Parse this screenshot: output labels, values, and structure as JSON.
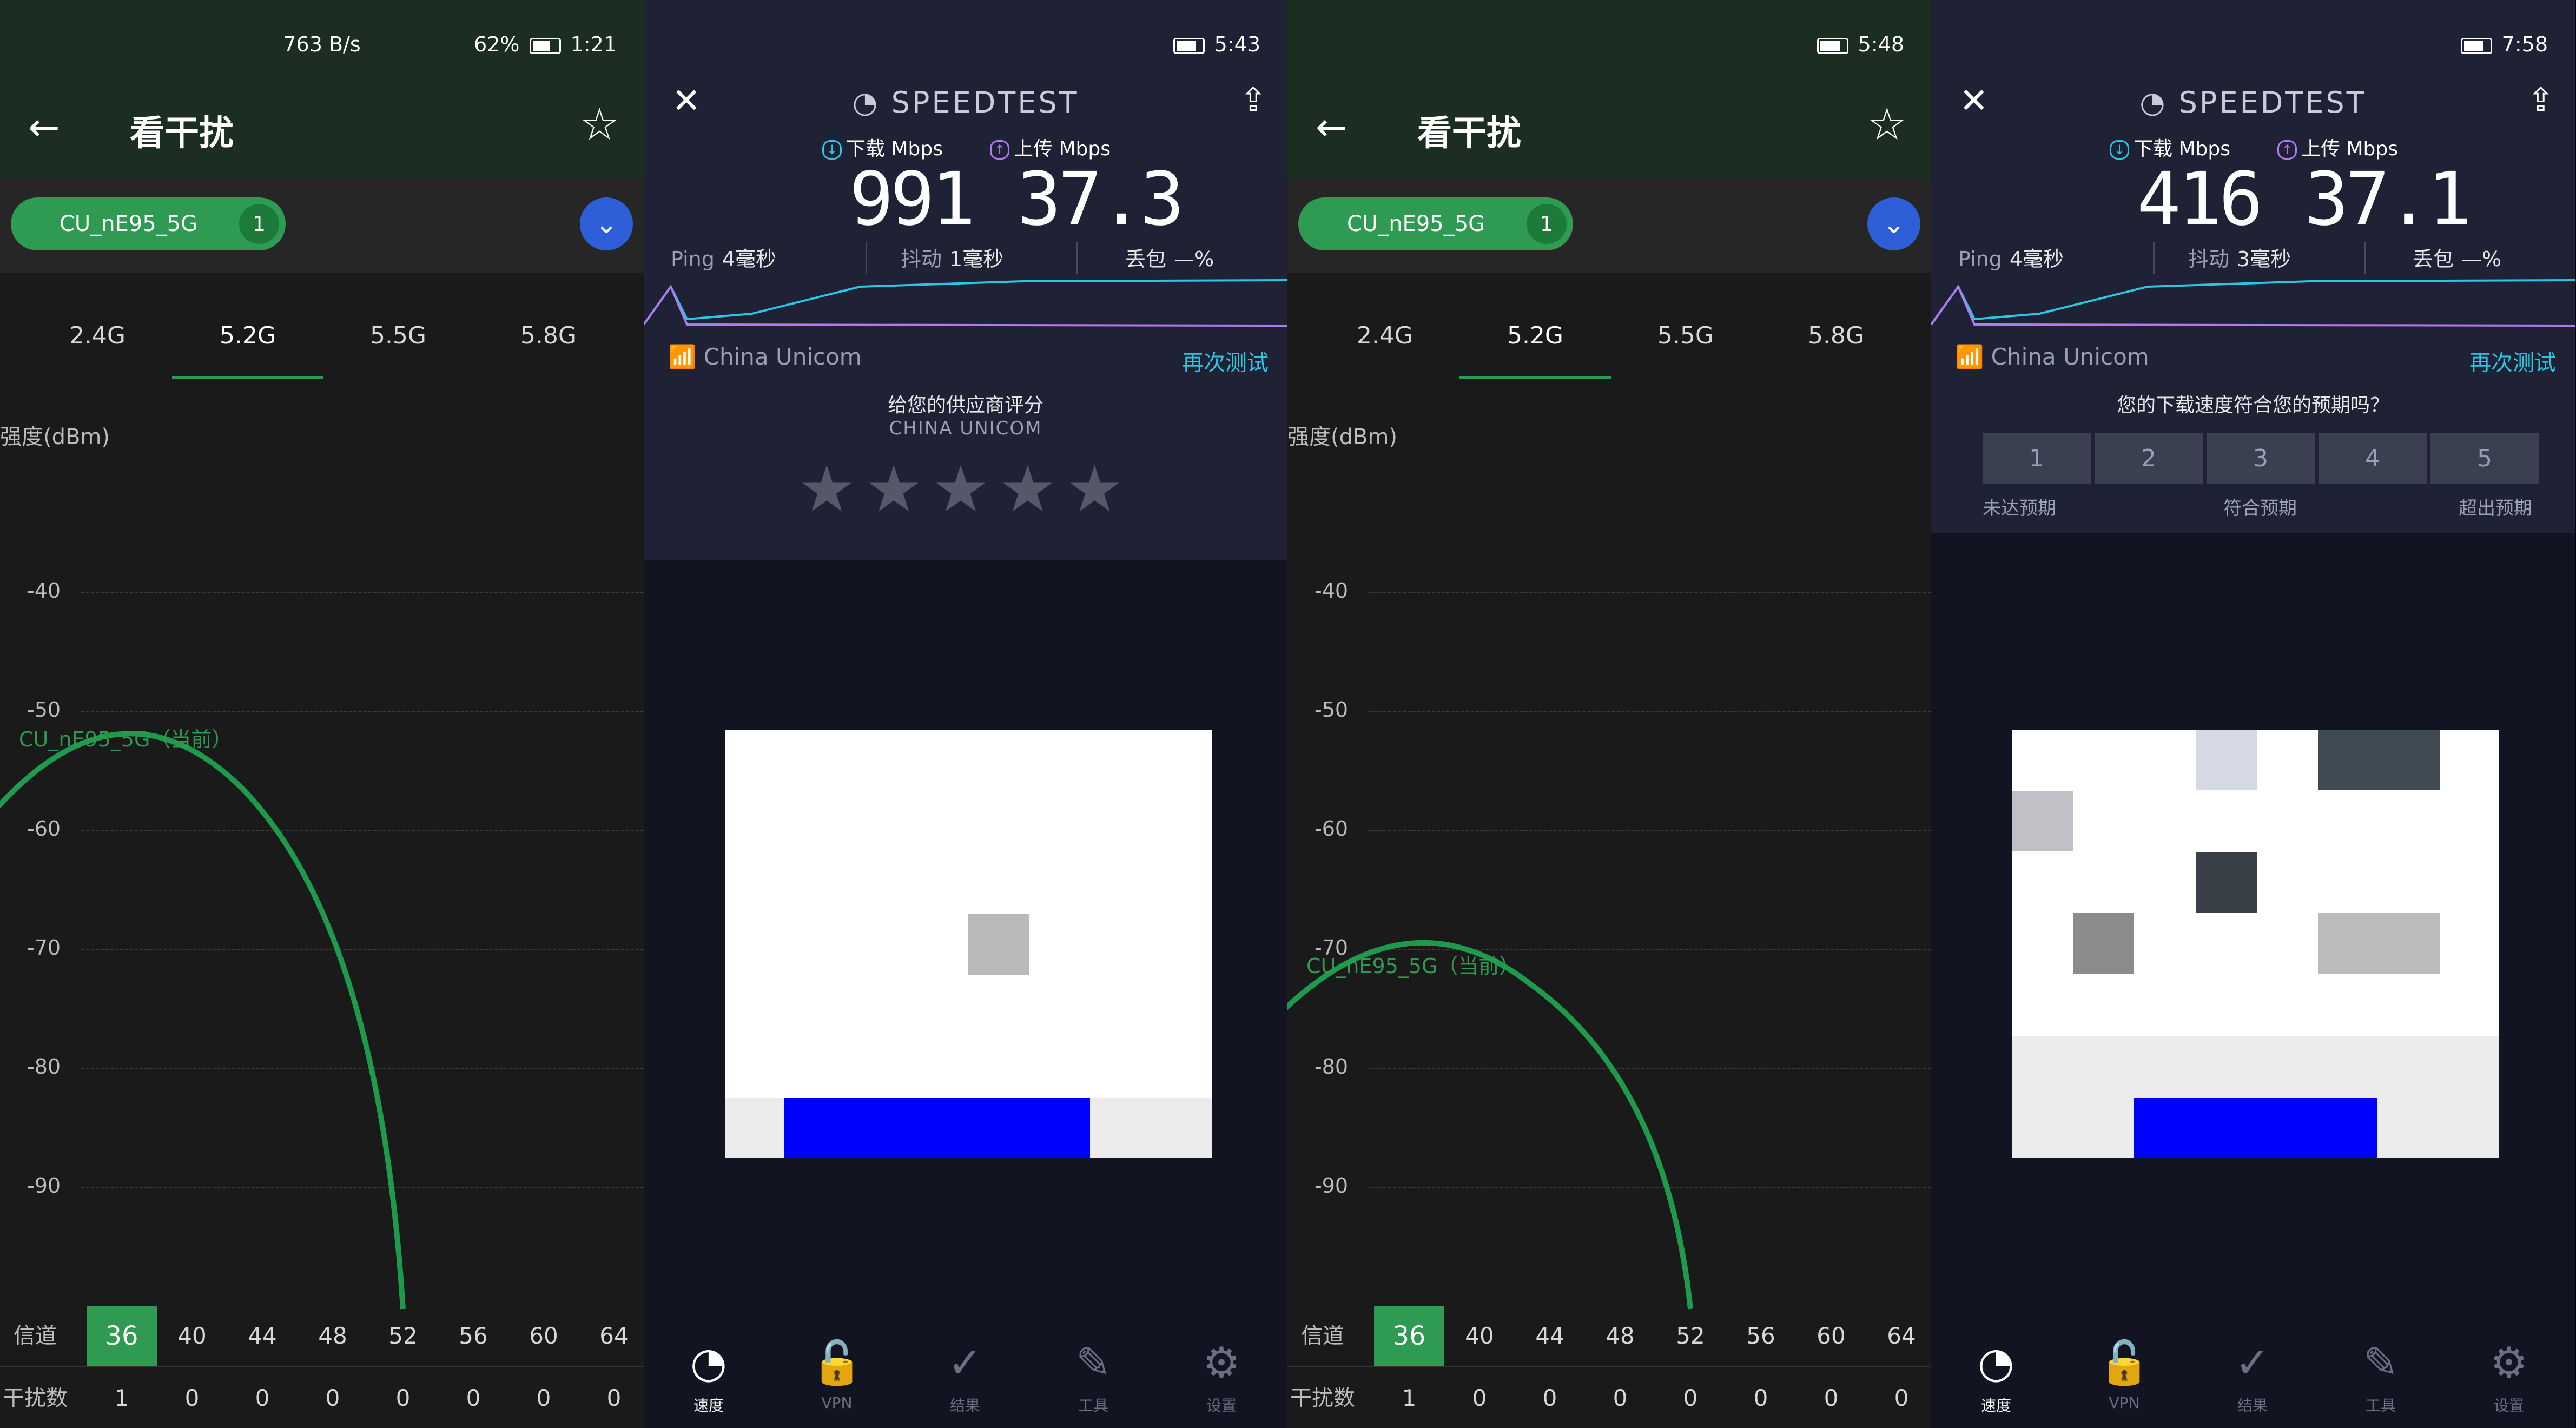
{
  "analyzer_screens": [
    {
      "status": {
        "speed": "763 B/s",
        "battery": "62%",
        "time": "1:21"
      },
      "title": "看干扰",
      "ssid_chip": {
        "name": "CU_nE95_5G",
        "count": "1"
      },
      "bands": [
        "2.4G",
        "5.2G",
        "5.5G",
        "5.8G"
      ],
      "selected_band": "5.2G",
      "y_axis_label": "强度(dBm)",
      "y_ticks": [
        "-40",
        "-50",
        "-60",
        "-70",
        "-80",
        "-90"
      ],
      "network_label": "CU_nE95_5G（当前）",
      "network_signal_dbm": -53,
      "channel_header": "信道",
      "interference_header": "干扰数",
      "channels": [
        "36",
        "40",
        "44",
        "48",
        "52",
        "56",
        "60",
        "64"
      ],
      "interference": [
        "1",
        "0",
        "0",
        "0",
        "0",
        "0",
        "0",
        "0"
      ],
      "active_channel": "36"
    },
    {
      "status": {
        "time": "5:48"
      },
      "title": "看干扰",
      "ssid_chip": {
        "name": "CU_nE95_5G",
        "count": "1"
      },
      "bands": [
        "2.4G",
        "5.2G",
        "5.5G",
        "5.8G"
      ],
      "selected_band": "5.2G",
      "y_axis_label": "强度(dBm)",
      "y_ticks": [
        "-40",
        "-50",
        "-60",
        "-70",
        "-80",
        "-90"
      ],
      "network_label": "CU_nE95_5G（当前）",
      "network_signal_dbm": -72,
      "channel_header": "信道",
      "interference_header": "干扰数",
      "channels": [
        "36",
        "40",
        "44",
        "48",
        "52",
        "56",
        "60",
        "64"
      ],
      "interference": [
        "1",
        "0",
        "0",
        "0",
        "0",
        "0",
        "0",
        "0"
      ],
      "active_channel": "36"
    }
  ],
  "speedtest_screens": [
    {
      "status": {
        "time": "5:43"
      },
      "brand": "SPEEDTEST",
      "download_label": "下载 Mbps",
      "upload_label": "上传 Mbps",
      "download_value": "991",
      "upload_value": "37.3",
      "ping_label": "Ping",
      "ping_value": "4毫秒",
      "jitter_label": "抖动",
      "jitter_value": "1毫秒",
      "loss_label": "丢包",
      "loss_value": "—%",
      "isp": "China Unicom",
      "retest": "再次测试",
      "prompt": "给您的供应商评分",
      "prompt_sub": "CHINA UNICOM",
      "rating_stars": "★★★★★",
      "tabs": [
        "速度",
        "VPN",
        "结果",
        "工具",
        "设置"
      ]
    },
    {
      "status": {
        "time": "7:58"
      },
      "brand": "SPEEDTEST",
      "download_label": "下载 Mbps",
      "upload_label": "上传 Mbps",
      "download_value": "416",
      "upload_value": "37.1",
      "ping_label": "Ping",
      "ping_value": "4毫秒",
      "jitter_label": "抖动",
      "jitter_value": "3毫秒",
      "loss_label": "丢包",
      "loss_value": "—%",
      "isp": "China Unicom",
      "retest": "再次测试",
      "prompt": "您的下载速度符合您的预期吗？",
      "rating_options": [
        "1",
        "2",
        "3",
        "4",
        "5"
      ],
      "rating_labels": [
        "未达预期",
        "符合预期",
        "超出预期"
      ],
      "tabs": [
        "速度",
        "VPN",
        "结果",
        "工具",
        "设置"
      ]
    }
  ],
  "colors": {
    "analyzer_bg": "#1a1a1a",
    "analyzer_header": "#1c2d22",
    "accent_green": "#2f9a52",
    "speedtest_bg": "#121422",
    "speedtest_card": "#1f2235",
    "cyan": "#2bc6e0",
    "purple": "#b07bf0"
  }
}
